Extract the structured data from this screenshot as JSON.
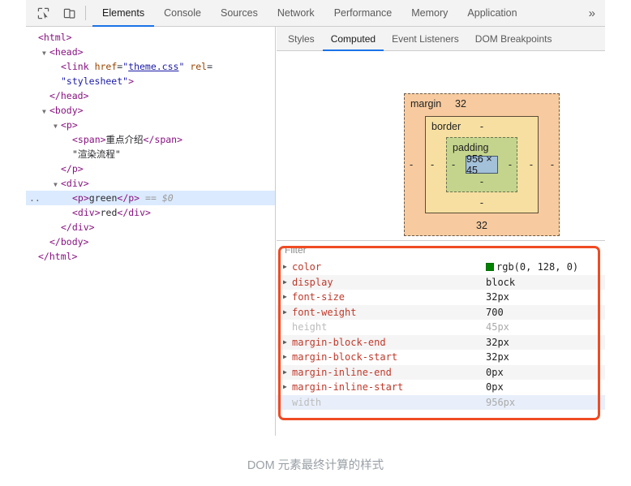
{
  "toolbar": {
    "icons": [
      {
        "name": "inspect-element-icon",
        "label": "Inspect element"
      },
      {
        "name": "device-toolbar-icon",
        "label": "Toggle device toolbar"
      }
    ],
    "tabs": [
      {
        "label": "Elements",
        "active": true
      },
      {
        "label": "Console",
        "active": false
      },
      {
        "label": "Sources",
        "active": false
      },
      {
        "label": "Network",
        "active": false
      },
      {
        "label": "Performance",
        "active": false
      },
      {
        "label": "Memory",
        "active": false
      },
      {
        "label": "Application",
        "active": false
      }
    ],
    "more_label": "»"
  },
  "dom_tree": {
    "rows": [
      {
        "indent": 0,
        "triangle": "",
        "html": "<span class=\"tag\">&lt;html&gt;</span>"
      },
      {
        "indent": 1,
        "triangle": "▼",
        "html": "<span class=\"tag\">&lt;head&gt;</span>"
      },
      {
        "indent": 2,
        "triangle": "",
        "html": "<span class=\"tag\">&lt;link</span> <span class=\"attr\">href</span>=<span class=\"val\">\"</span><span class=\"link\">theme.css</span><span class=\"val\">\"</span> <span class=\"attr\">rel</span>="
      },
      {
        "indent": 2,
        "triangle": "",
        "html": "<span class=\"val\">\"stylesheet\"</span><span class=\"tag\">&gt;</span>"
      },
      {
        "indent": 1,
        "triangle": "",
        "html": "<span class=\"tag\">&lt;/head&gt;</span>"
      },
      {
        "indent": 1,
        "triangle": "▼",
        "html": "<span class=\"tag\">&lt;body&gt;</span>"
      },
      {
        "indent": 2,
        "triangle": "▼",
        "html": "<span class=\"tag\">&lt;p&gt;</span>"
      },
      {
        "indent": 3,
        "triangle": "",
        "html": "<span class=\"tag\">&lt;span&gt;</span><span class=\"txt\">重点介绍</span><span class=\"tag\">&lt;/span&gt;</span>"
      },
      {
        "indent": 3,
        "triangle": "",
        "html": "<span class=\"txt\">\"渲染流程\"</span>"
      },
      {
        "indent": 2,
        "triangle": "",
        "html": "<span class=\"tag\">&lt;/p&gt;</span>"
      },
      {
        "indent": 2,
        "triangle": "▼",
        "html": "<span class=\"tag\">&lt;div&gt;</span>"
      },
      {
        "indent": 3,
        "triangle": "",
        "selected": true,
        "ellipsis": "..",
        "html": "<span class=\"tag\">&lt;p&gt;</span><span class=\"txt\">green</span><span class=\"tag\">&lt;/p&gt;</span> <span class=\"dollar\">== $0</span>"
      },
      {
        "indent": 3,
        "triangle": "",
        "html": "<span class=\"tag\">&lt;div&gt;</span><span class=\"txt\">red</span><span class=\"tag\">&lt;/div&gt;</span>"
      },
      {
        "indent": 2,
        "triangle": "",
        "html": "<span class=\"tag\">&lt;/div&gt;</span>"
      },
      {
        "indent": 1,
        "triangle": "",
        "html": "<span class=\"tag\">&lt;/body&gt;</span>"
      },
      {
        "indent": 0,
        "triangle": "",
        "html": "<span class=\"tag\">&lt;/html&gt;</span>"
      }
    ]
  },
  "sidebar": {
    "tabs": [
      {
        "label": "Styles",
        "active": false
      },
      {
        "label": "Computed",
        "active": true
      },
      {
        "label": "Event Listeners",
        "active": false
      },
      {
        "label": "DOM Breakpoints",
        "active": false
      }
    ]
  },
  "box_model": {
    "margin": {
      "label": "margin",
      "top": "32",
      "right": "-",
      "bottom": "32",
      "left": "-"
    },
    "border": {
      "label": "border",
      "top": "-",
      "right": "-",
      "bottom": "-",
      "left": "-"
    },
    "padding": {
      "label": "padding",
      "top": "",
      "right": "-",
      "bottom": "-",
      "left": "-"
    },
    "content": "956 × 45",
    "colors": {
      "margin": "#f7cb9f",
      "border": "#f6dfa1",
      "padding": "#c4d48c",
      "content": "#a3c1d9"
    }
  },
  "filter": {
    "placeholder": "Filter"
  },
  "computed": {
    "properties": [
      {
        "name": "color",
        "value": "rgb(0, 128, 0)",
        "expandable": true,
        "greyed": false,
        "swatch": "#008000"
      },
      {
        "name": "display",
        "value": "block",
        "expandable": true,
        "greyed": false
      },
      {
        "name": "font-size",
        "value": "32px",
        "expandable": true,
        "greyed": false
      },
      {
        "name": "font-weight",
        "value": "700",
        "expandable": true,
        "greyed": false
      },
      {
        "name": "height",
        "value": "45px",
        "expandable": false,
        "greyed": true
      },
      {
        "name": "margin-block-end",
        "value": "32px",
        "expandable": true,
        "greyed": false
      },
      {
        "name": "margin-block-start",
        "value": "32px",
        "expandable": true,
        "greyed": false
      },
      {
        "name": "margin-inline-end",
        "value": "0px",
        "expandable": true,
        "greyed": false
      },
      {
        "name": "margin-inline-start",
        "value": "0px",
        "expandable": true,
        "greyed": false
      },
      {
        "name": "width",
        "value": "956px",
        "expandable": false,
        "greyed": true,
        "highlighted": true
      }
    ]
  },
  "annotation": {
    "color": "#ef4b23"
  },
  "caption": {
    "text": "DOM 元素最终计算的样式"
  }
}
